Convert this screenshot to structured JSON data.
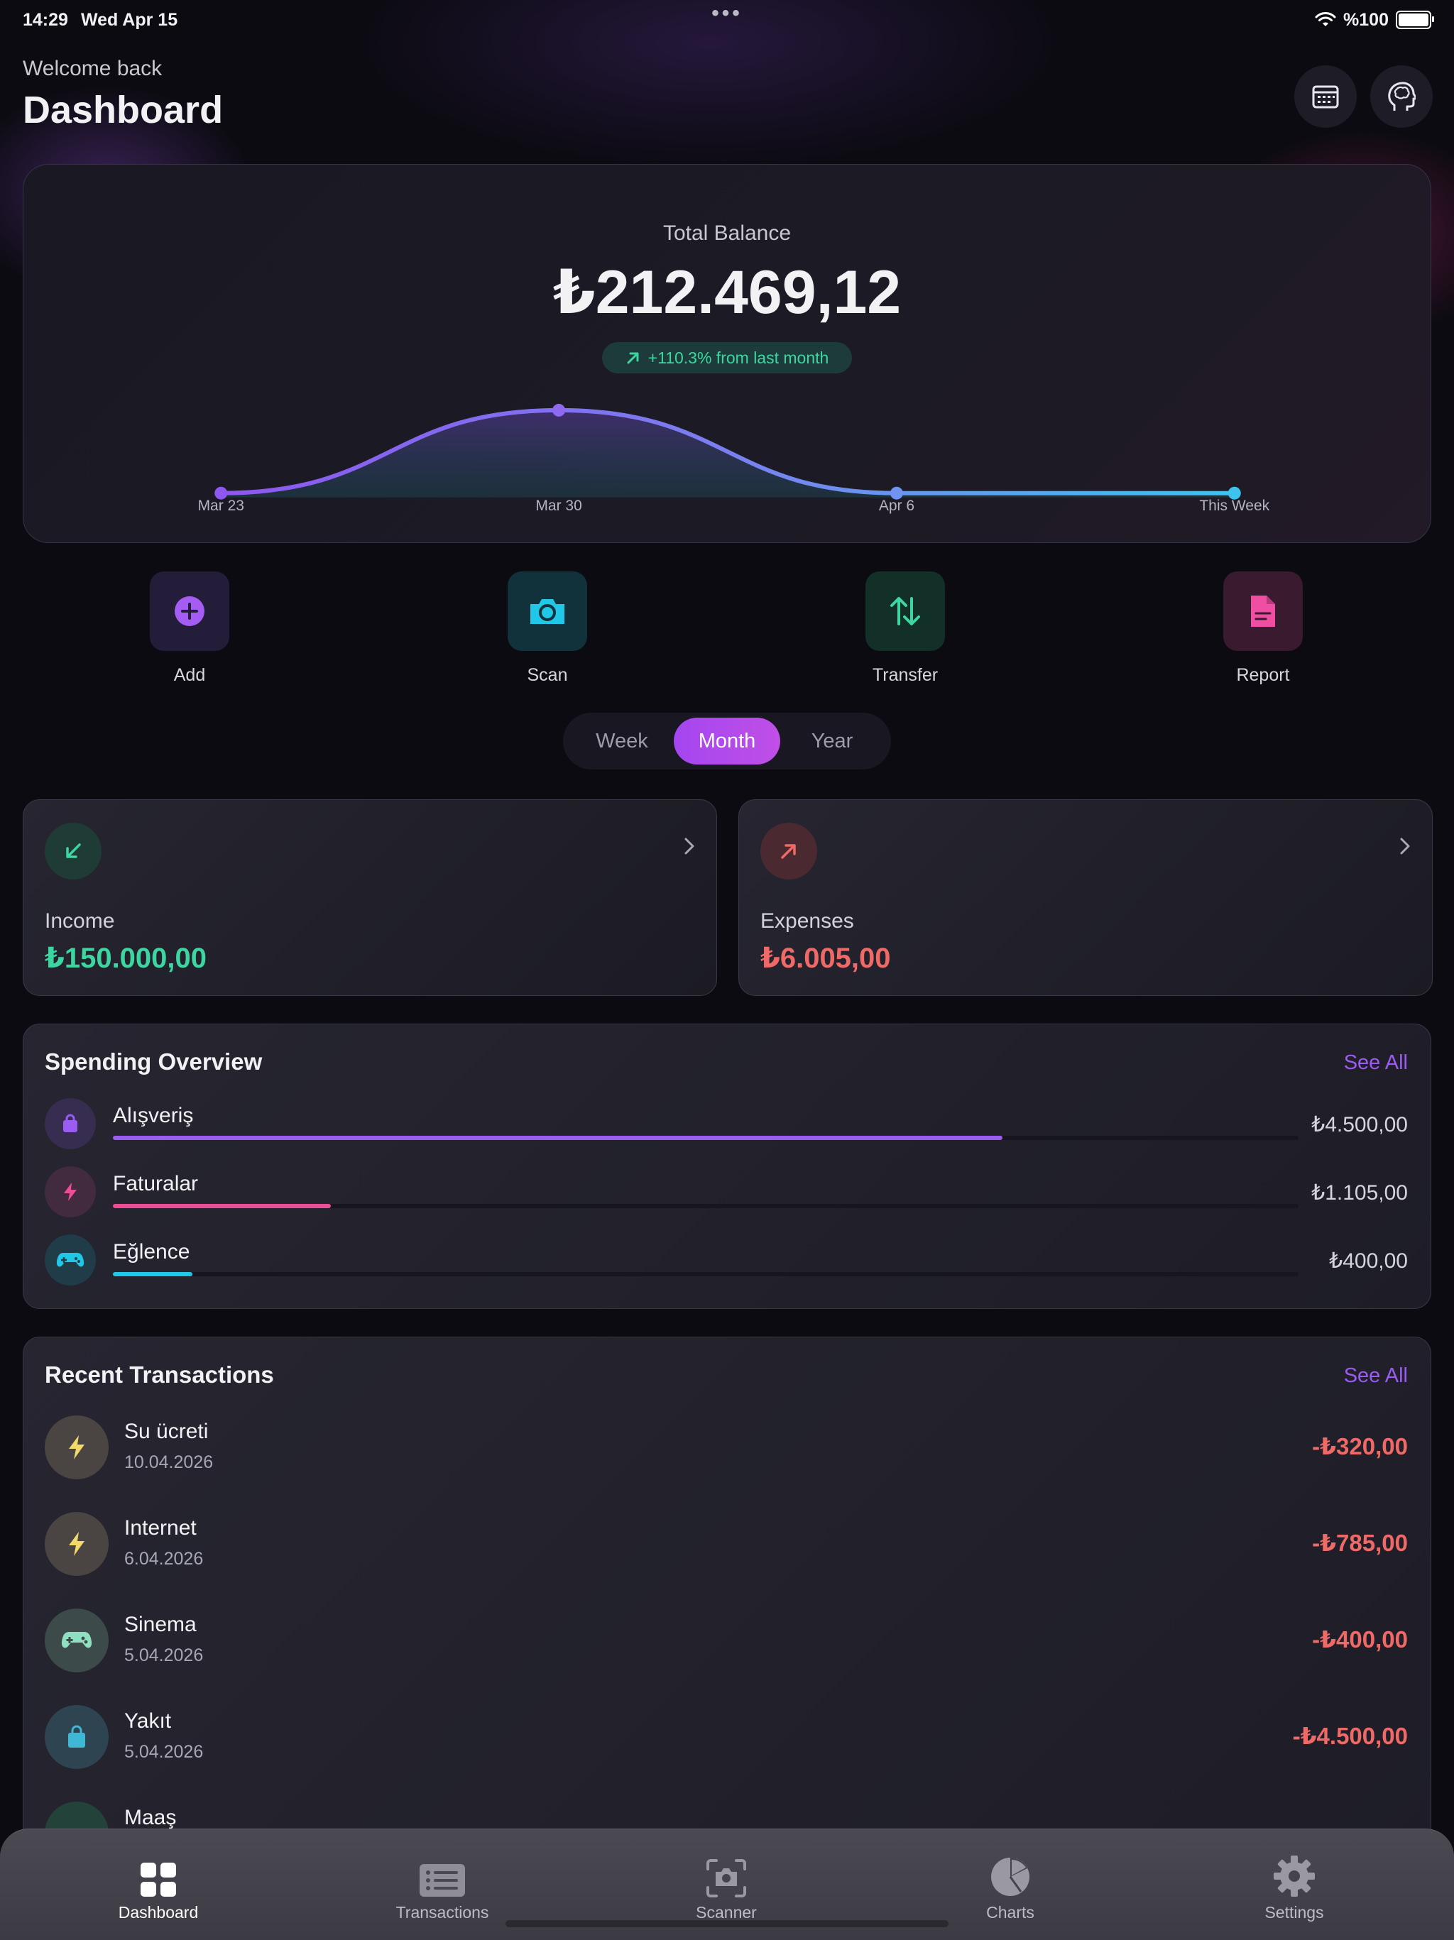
{
  "status_bar": {
    "time": "14:29",
    "date": "Wed Apr 15",
    "battery": "%100"
  },
  "header": {
    "welcome": "Welcome back",
    "title": "Dashboard"
  },
  "balance": {
    "label": "Total Balance",
    "amount": "₺212.469,12",
    "change": "+110.3% from last month"
  },
  "chart_data": {
    "type": "line",
    "categories": [
      "Mar 23",
      "Mar 30",
      "Apr 6",
      "This Week"
    ],
    "values": [
      0.0,
      1.0,
      0.0,
      0.0
    ]
  },
  "quick_actions": [
    {
      "label": "Add",
      "icon": "plus-circle-icon",
      "color": "#a45cf2"
    },
    {
      "label": "Scan",
      "icon": "camera-icon",
      "color": "#20c7e6"
    },
    {
      "label": "Transfer",
      "icon": "arrows-up-down-icon",
      "color": "#3ed6a0"
    },
    {
      "label": "Report",
      "icon": "document-icon",
      "color": "#f04ea3"
    }
  ],
  "period": {
    "options": [
      "Week",
      "Month",
      "Year"
    ],
    "selected": "Month"
  },
  "income": {
    "label": "Income",
    "value": "₺150.000,00",
    "color": "#3ed6a0"
  },
  "expenses": {
    "label": "Expenses",
    "value": "₺6.005,00",
    "color": "#ef6a67"
  },
  "spending": {
    "title": "Spending Overview",
    "see_all": "See All",
    "items": [
      {
        "name": "Alışveriş",
        "amount": "₺4.500,00",
        "fraction": 0.75,
        "color": "#9a5cf2",
        "icon": "shopping-bag-icon"
      },
      {
        "name": "Faturalar",
        "amount": "₺1.105,00",
        "fraction": 0.184,
        "color": "#ec4d95",
        "icon": "bolt-icon"
      },
      {
        "name": "Eğlence",
        "amount": "₺400,00",
        "fraction": 0.067,
        "color": "#20c7e6",
        "icon": "gamepad-icon"
      }
    ]
  },
  "transactions": {
    "title": "Recent Transactions",
    "see_all": "See All",
    "items": [
      {
        "name": "Su ücreti",
        "date": "10.04.2026",
        "amount": "-₺320,00",
        "icon": "bolt-icon"
      },
      {
        "name": "Internet",
        "date": "6.04.2026",
        "amount": "-₺785,00",
        "icon": "bolt-icon"
      },
      {
        "name": "Sinema",
        "date": "5.04.2026",
        "amount": "-₺400,00",
        "icon": "gamepad-icon"
      },
      {
        "name": "Yakıt",
        "date": "5.04.2026",
        "amount": "-₺4.500,00",
        "icon": "shopping-bag-icon"
      },
      {
        "name": "Maaş",
        "date": "",
        "amount": "",
        "icon": "arrow-down-left-icon"
      }
    ]
  },
  "tabbar": [
    {
      "label": "Dashboard",
      "icon": "grid-icon",
      "active": true
    },
    {
      "label": "Transactions",
      "icon": "list-icon",
      "active": false
    },
    {
      "label": "Scanner",
      "icon": "camera-scan-icon",
      "active": false
    },
    {
      "label": "Charts",
      "icon": "pie-chart-icon",
      "active": false
    },
    {
      "label": "Settings",
      "icon": "gear-icon",
      "active": false
    }
  ]
}
